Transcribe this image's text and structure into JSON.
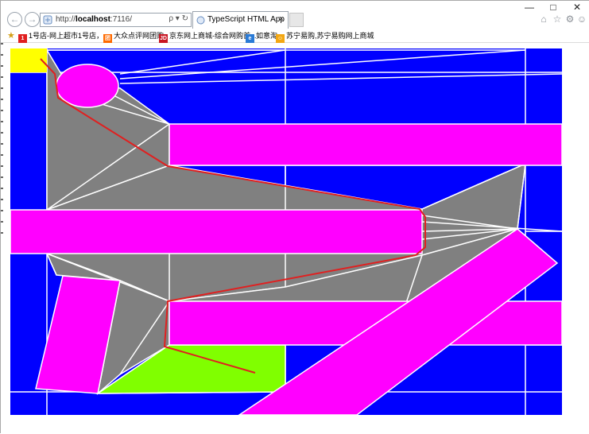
{
  "browser": {
    "address_url_prefix": "http://",
    "address_url_host": "localhost",
    "address_url_suffix": ":7116/",
    "address_icons": "ρ ▾ ↻",
    "tab_title": "TypeScript HTML App",
    "tab_close": "×",
    "window_minimize": "—",
    "window_maximize": "□",
    "window_close": "✕"
  },
  "favorites": [
    {
      "icon_text": "1",
      "icon_color": "#e02020",
      "label": "1号店-网上超市1号店，..."
    },
    {
      "icon_text": "团",
      "icon_color": "#ff6a00",
      "label": "大众点评网团购"
    },
    {
      "icon_text": "JD",
      "icon_color": "#c81623",
      "label": "京东网上商城-综合网购首..."
    },
    {
      "icon_text": "e",
      "icon_color": "#2b7bd6",
      "label": "如意淘"
    },
    {
      "icon_text": "☺",
      "icon_color": "#f3a712",
      "label": "苏宁易购,苏宁易购网上商城"
    }
  ],
  "colors": {
    "background_blue": "#0000ff",
    "obstacle_magenta": "#ff00ff",
    "navmesh_gray": "#808080",
    "start_yellow": "#ffff00",
    "goal_green": "#80ff00",
    "path_red": "#e02020",
    "grid_white": "#ffffff"
  },
  "icons": [
    "back-arrow-icon",
    "forward-arrow-icon",
    "page-favicon-icon",
    "search-icon",
    "refresh-icon",
    "home-icon",
    "star-icon",
    "gear-icon",
    "smiley-icon",
    "favorites-star-icon"
  ]
}
